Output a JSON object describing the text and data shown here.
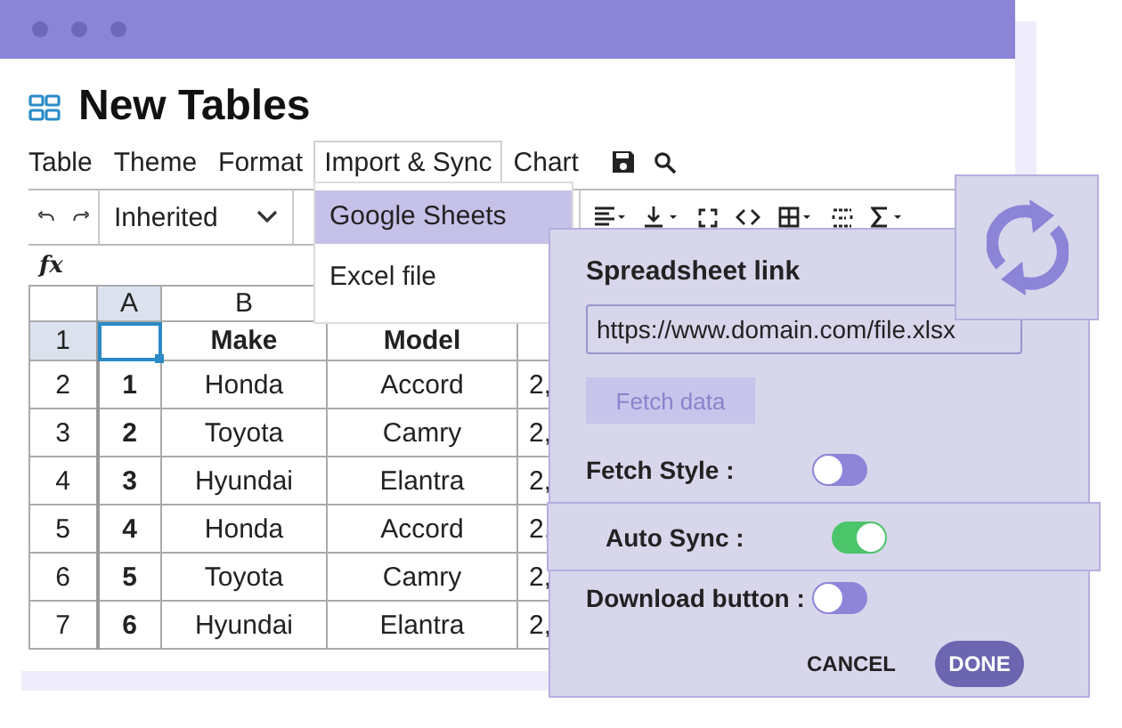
{
  "title": "New Tables",
  "menu": [
    {
      "label": "Table",
      "selected": false
    },
    {
      "label": "Theme",
      "selected": false
    },
    {
      "label": "Format",
      "selected": false
    },
    {
      "label": "Import & Sync",
      "selected": true
    },
    {
      "label": "Chart",
      "selected": false
    }
  ],
  "toolbar": {
    "font_select": "Inherited"
  },
  "formula_label": "fx",
  "grid": {
    "columns": [
      {
        "label": "A",
        "selected": true
      },
      {
        "label": "B",
        "selected": false
      }
    ],
    "rows": [
      {
        "header": "1",
        "selected": true,
        "kind": "header",
        "cells": [
          "",
          "Make",
          "Model"
        ]
      },
      {
        "header": "2",
        "selected": false,
        "kind": "data",
        "cells": [
          "1",
          "Honda",
          "Accord",
          "2,"
        ]
      },
      {
        "header": "3",
        "selected": false,
        "kind": "data",
        "cells": [
          "2",
          "Toyota",
          "Camry",
          "2,"
        ]
      },
      {
        "header": "4",
        "selected": false,
        "kind": "data",
        "cells": [
          "3",
          "Hyundai",
          "Elantra",
          "2,"
        ]
      },
      {
        "header": "5",
        "selected": false,
        "kind": "data",
        "cells": [
          "4",
          "Honda",
          "Accord",
          "2,"
        ]
      },
      {
        "header": "6",
        "selected": false,
        "kind": "data",
        "cells": [
          "5",
          "Toyota",
          "Camry",
          "2,"
        ]
      },
      {
        "header": "7",
        "selected": false,
        "kind": "data",
        "cells": [
          "6",
          "Hyundai",
          "Elantra",
          "2,"
        ]
      }
    ]
  },
  "dropdown": [
    {
      "label": "Google Sheets",
      "selected": true
    },
    {
      "label": "Excel file",
      "selected": false
    }
  ],
  "sync_panel": {
    "title": "Spreadsheet link",
    "url": "https://www.domain.com/file.xlsx",
    "fetch_button": {
      "label": "Fetch data",
      "disabled": true
    },
    "toggles": [
      {
        "label": "Fetch Style :",
        "on": false,
        "raised": false
      },
      {
        "label": "Auto Sync :",
        "on": true,
        "raised": true
      },
      {
        "label": "Download button :",
        "on": false,
        "raised": false
      }
    ],
    "buttons": [
      {
        "label": "CANCEL",
        "kind": "text"
      },
      {
        "label": "DONE",
        "kind": "primary"
      }
    ]
  }
}
